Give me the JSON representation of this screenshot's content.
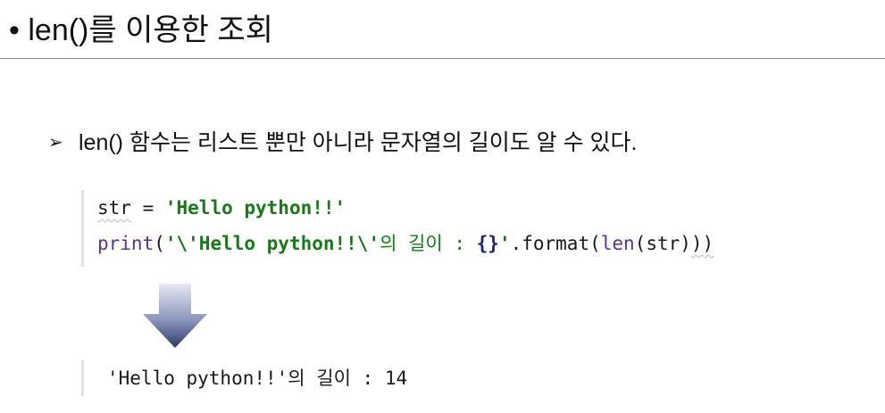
{
  "slide": {
    "title": "• len()를 이용한 조회",
    "bullet_marker": "➢",
    "bullet_text": "len() 함수는 리스트 뿐만 아니라 문자열의 길이도 알 수 있다."
  },
  "code": {
    "line1": {
      "var": "str",
      "op": " = ",
      "value": "'Hello python!!'"
    },
    "line2": {
      "func": "print",
      "open": "(",
      "str_start": "'\\'Hello python!!\\'",
      "str_korean": "의 길이 : ",
      "placeholder": "{}",
      "str_end": "'",
      "method": ".format(",
      "inner_func": "len",
      "inner_args": "(str)",
      "close": "))"
    }
  },
  "output": {
    "text": "'Hello python!!'의 길이 : 14"
  },
  "colors": {
    "title_rule": "#6f86c6",
    "code_string": "#167c16",
    "code_builtin": "#5b2ea6",
    "arrow_top": "#e6e9f3",
    "arrow_bottom": "#2e3b6b"
  }
}
